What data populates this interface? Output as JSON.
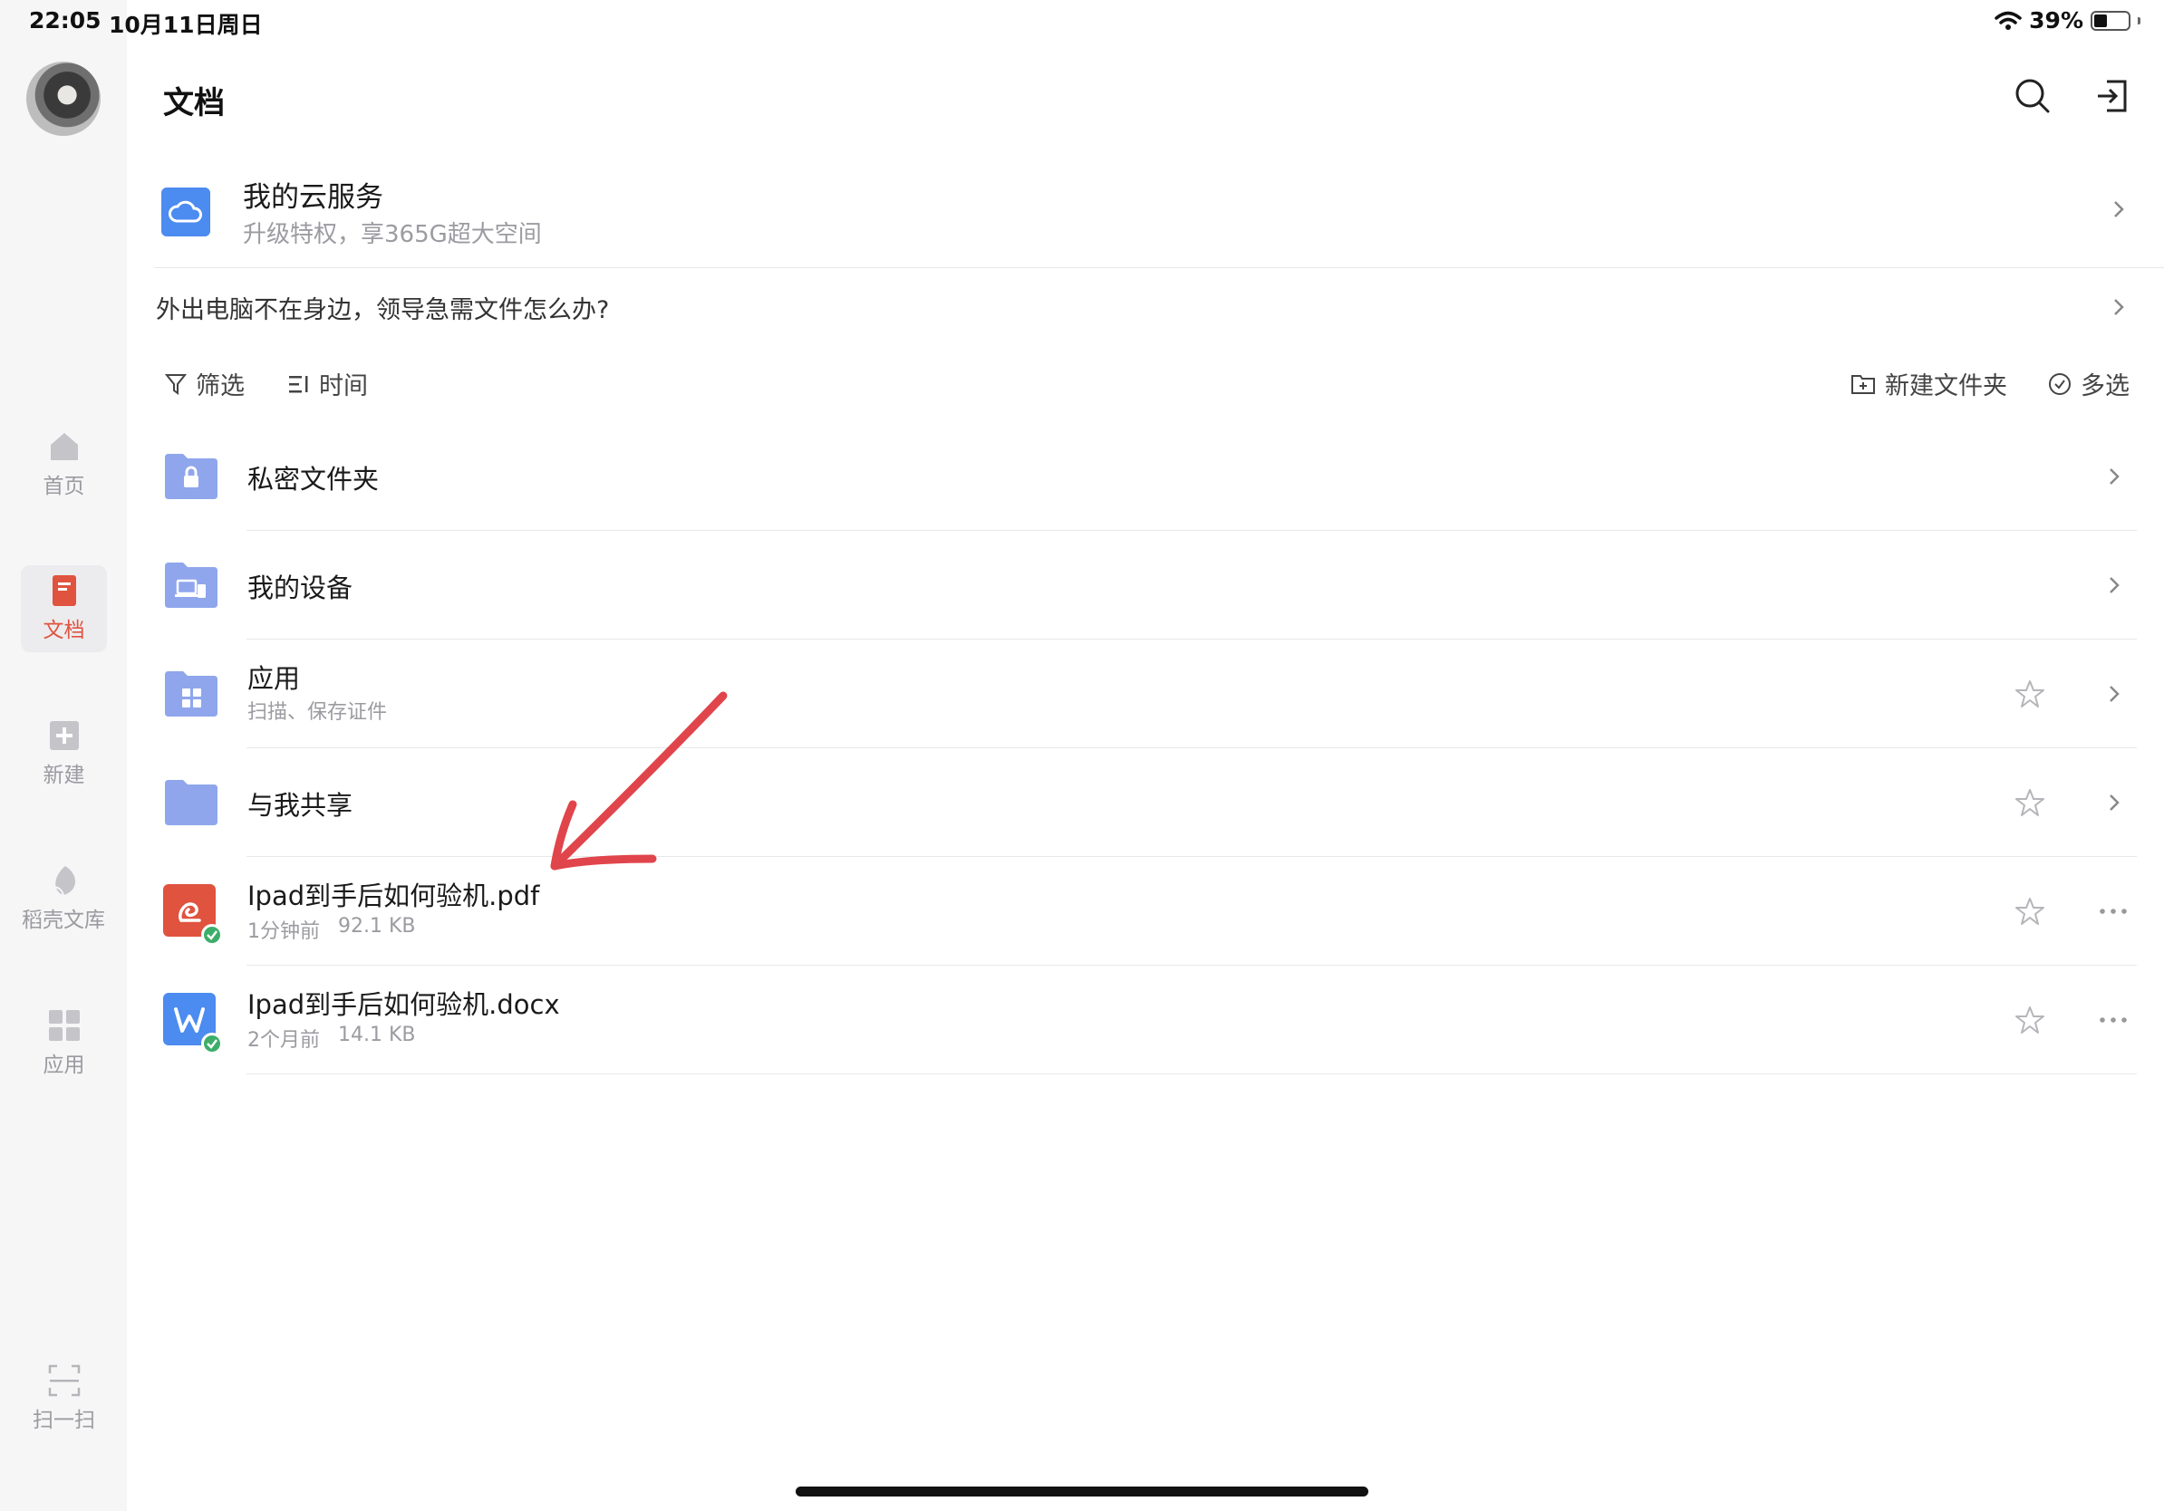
{
  "status_bar": {
    "time": "22:05",
    "date": "10月11日周日",
    "battery": "39%",
    "battery_level": 0.39
  },
  "sidebar": {
    "items": [
      {
        "label": "首页",
        "icon": "home-icon"
      },
      {
        "label": "文档",
        "icon": "document-icon",
        "active": true
      },
      {
        "label": "新建",
        "icon": "plus-icon"
      },
      {
        "label": "稻壳文库",
        "icon": "leaf-icon"
      },
      {
        "label": "应用",
        "icon": "apps-grid-icon"
      }
    ],
    "scan_label": "扫一扫"
  },
  "header": {
    "title": "文档"
  },
  "cloud": {
    "title": "我的云服务",
    "subtitle": "升级特权，享365G超大空间"
  },
  "tip": {
    "text": "外出电脑不在身边，领导急需文件怎么办?"
  },
  "toolbar": {
    "filter_label": "筛选",
    "sort_label": "时间",
    "new_folder_label": "新建文件夹",
    "multi_select_label": "多选"
  },
  "list": [
    {
      "title": "私密文件夹",
      "subtitle": "",
      "type": "folder-lock"
    },
    {
      "title": "我的设备",
      "subtitle": "",
      "type": "folder-device"
    },
    {
      "title": "应用",
      "subtitle": "扫描、保存证件",
      "type": "folder-apps"
    },
    {
      "title": "与我共享",
      "subtitle": "",
      "type": "folder-shared"
    },
    {
      "title": "Ipad到手后如何验机.pdf",
      "time": "1分钟前",
      "size": "92.1 KB",
      "type": "pdf"
    },
    {
      "title": "Ipad到手后如何验机.docx",
      "time": "2个月前",
      "size": "14.1 KB",
      "type": "docx"
    }
  ],
  "colors": {
    "accent": "#e0533f",
    "folder": "#8fa6ec",
    "pdf": "#e0533f",
    "docx": "#4c8bf0",
    "cloud": "#4c8bf0",
    "arrow": "#e0454b",
    "sync": "#3cae6a"
  }
}
